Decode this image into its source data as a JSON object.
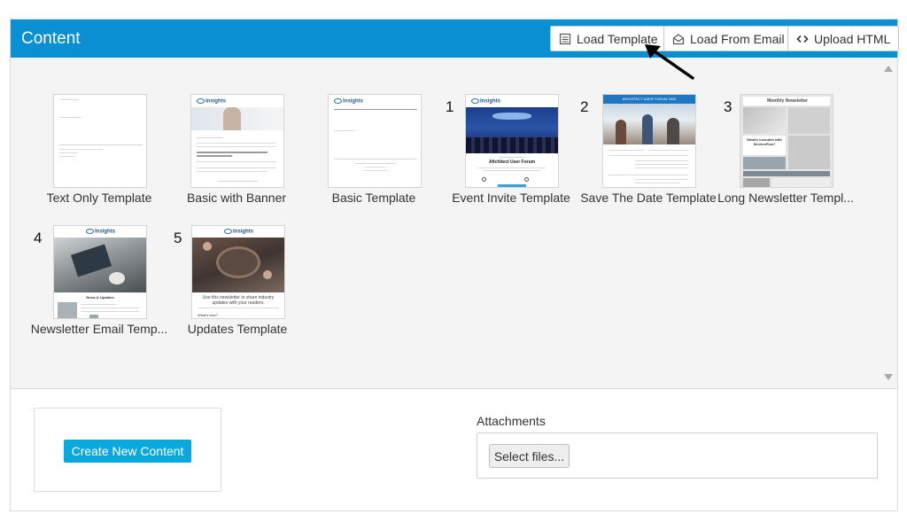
{
  "header": {
    "title": "Content",
    "buttons": {
      "load_template": "Load Template",
      "load_from_email": "Load From Email",
      "upload_html": "Upload HTML"
    }
  },
  "templates": [
    {
      "label": "Text Only Template",
      "number": ""
    },
    {
      "label": "Basic with Banner",
      "number": ""
    },
    {
      "label": "Basic Template",
      "number": ""
    },
    {
      "label": "Event Invite Template",
      "number": "1"
    },
    {
      "label": "Save The Date Template",
      "number": "2"
    },
    {
      "label": "Long Newsletter Templ...",
      "number": "3"
    },
    {
      "label": "Newsletter Email Temp...",
      "number": "4"
    },
    {
      "label": "Updates Template",
      "number": "5"
    }
  ],
  "thumb_text": {
    "insights": "Insights",
    "event_title": "Afichitect User Forum",
    "save_date_banner": "ARCHITECT USER FORUM 2020",
    "monthly_newsletter": "Monthly Newsletter",
    "whats_included": "What's included with ServicePlus?",
    "news_updates": "News & Updates",
    "updates_text": "Use this newsletter to share industry updates with your readers.",
    "whats_new": "What's new?"
  },
  "create_new_content": "Create New Content",
  "attachments": {
    "label": "Attachments",
    "select_files": "Select files..."
  },
  "colors": {
    "header": "#0b8fd3",
    "create_button": "#0aa9dd"
  }
}
